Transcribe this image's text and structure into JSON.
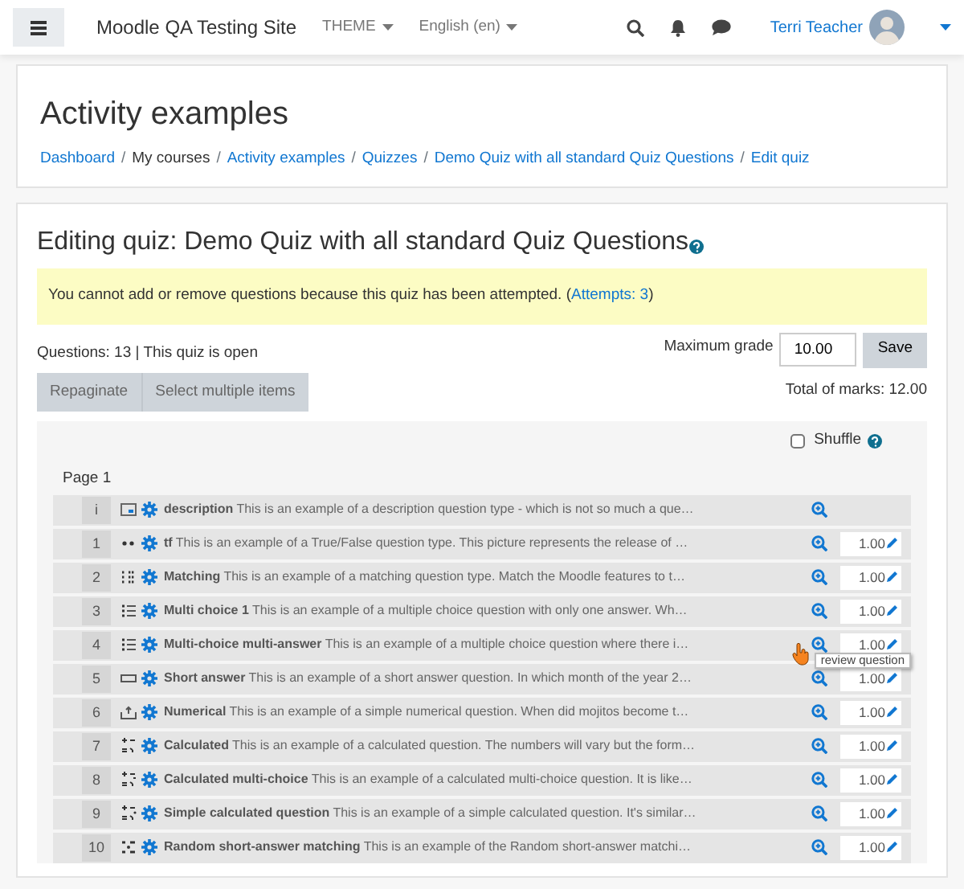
{
  "navbar": {
    "site_name": "Moodle QA Testing Site",
    "menus": [
      {
        "label": "THEME"
      },
      {
        "label": "English (en)"
      }
    ],
    "user_name": "Terri Teacher"
  },
  "header": {
    "title": "Activity examples",
    "breadcrumb": [
      "Dashboard",
      "My courses",
      "Activity examples",
      "Quizzes",
      "Demo Quiz with all standard Quiz Questions",
      "Edit quiz"
    ],
    "separator": "/"
  },
  "quiz": {
    "title": "Editing quiz: Demo Quiz with all standard Quiz Questions",
    "alert": "You cannot add or remove questions because this quiz has been attempted. (",
    "alert_link": "Attempts: 3",
    "alert_end": ")",
    "info": "Questions: 13 | This quiz is open",
    "max_grade_label": "Maximum grade",
    "max_grade": "10.00",
    "save": "Save",
    "buttons": [
      "Repaginate",
      "Select multiple items"
    ],
    "total_marks": "Total of marks: 12.00",
    "shuffle": {
      "label": "Shuffle",
      "checked": false
    },
    "page_label": "Page 1",
    "rows": [
      {
        "number": "i",
        "kind": "description",
        "name": "description",
        "text": "This is an example of a description question type - which is not so much a que…"
      },
      {
        "number": "1",
        "kind": "truefalse",
        "name": "tf",
        "text": "This is an example of a True/False question type. This picture represents the release of  …",
        "mark": "1.00"
      },
      {
        "number": "2",
        "kind": "match",
        "name": "Matching",
        "text": "This is an example of a matching question type. Match the Moodle features to t…",
        "mark": "1.00"
      },
      {
        "number": "3",
        "kind": "multichoice",
        "name": "Multi choice 1",
        "text": "This is an example of a multiple choice question with only one answer. Wh…",
        "mark": "1.00"
      },
      {
        "number": "4",
        "kind": "multichoice",
        "name": "Multi-choice multi-answer",
        "text": "This is an example of a multiple choice question where there i…",
        "mark": "1.00"
      },
      {
        "number": "5",
        "kind": "shortanswer",
        "name": "Short answer",
        "text": "This is an example of a short answer question. In which month of the year 2…",
        "mark": "1.00"
      },
      {
        "number": "6",
        "kind": "numerical",
        "name": "Numerical",
        "text": "This is an example of a simple numerical question. When did mojitos become t…",
        "mark": "1.00"
      },
      {
        "number": "7",
        "kind": "calculated",
        "name": "Calculated",
        "text": "This is an example of a calculated question. The numbers will vary but the form…",
        "mark": "1.00"
      },
      {
        "number": "8",
        "kind": "calculatedmulti",
        "name": "Calculated multi-choice",
        "text": "This is an example of a calculated multi-choice question. It is like…",
        "mark": "1.00"
      },
      {
        "number": "9",
        "kind": "calculatedsimple",
        "name": "Simple calculated question",
        "text": "This is an example of a simple calculated question. It's similar…",
        "mark": "1.00"
      },
      {
        "number": "10",
        "kind": "randomsamatch",
        "name": "Random short-answer matching",
        "text": "This is an example of the Random short-answer matchi…",
        "mark": "1.00"
      }
    ],
    "tooltip": "review question"
  }
}
